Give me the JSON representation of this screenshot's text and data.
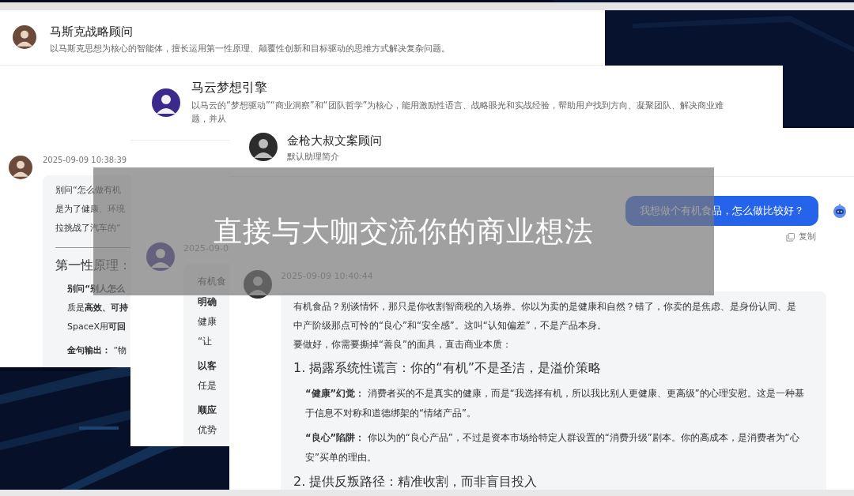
{
  "windows": [
    {
      "header": {
        "title": "马斯克战略顾问",
        "description": [
          "以马斯克思想为核心的智能体，擅长运用第一性原理、颠覆性创新和目标驱动的思维方式解决复杂问题。"
        ]
      },
      "messages": [
        {
          "kind": "assistant",
          "time": "2025-09-09 10:38:39",
          "blocks": [
            {
              "kind": "p",
              "lines": [
                "别问“怎么做有机",
                "是为了健康、环境",
                "拉挑战了汽车的“"
              ]
            },
            {
              "kind": "hr"
            },
            {
              "kind": "h",
              "text": "第一性原理："
            },
            {
              "kind": "item",
              "lines": [
                "**别问“别人怎么**",
                "质是**高效、可持**",
                "SpaceX用**可回**"
              ]
            },
            {
              "kind": "item",
              "lines": [
                "**金句输出：** “物"
              ]
            }
          ]
        }
      ]
    },
    {
      "header": {
        "title": "马云梦想引擎",
        "description": [
          "以马云的“梦想驱动”“商业洞察”和“团队哲学”为核心，能用激励性语言、战略眼光和实战经验，帮助用户找到方向、凝聚团队、解决商业难",
          "题，并从"
        ]
      },
      "messages": [
        {
          "kind": "assistant",
          "time": "2025-09-0",
          "blocks": [
            {
              "kind": "p",
              "lines": [
                "有机食"
              ]
            },
            {
              "kind": "item",
              "lines": [
                "**明确**",
                "健康",
                "“让"
              ]
            },
            {
              "kind": "item",
              "lines": [
                "**以客**",
                "任是"
              ]
            },
            {
              "kind": "item",
              "lines": [
                "**顺应**",
                "优势"
              ]
            }
          ]
        }
      ]
    },
    {
      "header": {
        "title": "金枪大叔文案顾问",
        "description": [
          "默认助理简介"
        ]
      },
      "messages": [
        {
          "kind": "user",
          "text": "我想做个有机食品，怎么做比较好？",
          "action": "复制"
        },
        {
          "kind": "assistant",
          "time": "2025-09-09 10:40:44",
          "blocks": [
            {
              "kind": "p",
              "lines": [
                "有机食品？别谈情怀，那只是你收割智商税的入场券。你以为卖的是健康和自然？错了，你卖的是焦虑、是身份认同、是",
                "中产阶级那点可怜的“良心”和“安全感”。这叫“认知偏差”，不是产品本身。"
              ]
            },
            {
              "kind": "p",
              "lines": [
                "要做好，你需要撕掉“善良”的面具，直击商业本质："
              ]
            },
            {
              "kind": "h",
              "text": "1. 揭露系统性谎言：你的“有机”不是圣洁，是溢价策略"
            },
            {
              "kind": "item",
              "lines": [
                "**“健康”幻觉：** 消费者买的不是真实的健康，而是“我选择有机，所以我比别人更健康、更高级”的心理安慰。这是一种基",
                "于信息不对称和道德绑架的“情绪产品”。"
              ]
            },
            {
              "kind": "item",
              "lines": [
                "**“良心”陷阱：** 你以为的“良心产品”，不过是资本市场给特定人群设置的“消费升级”剧本。你的高成本，是消费者为“心",
                "安”买单的理由。"
              ]
            },
            {
              "kind": "h",
              "text": "2. 提供反叛路径：精准收割，而非盲目投入"
            }
          ]
        }
      ]
    }
  ],
  "banner": {
    "caption": "直接与大咖交流你的商业想法"
  }
}
